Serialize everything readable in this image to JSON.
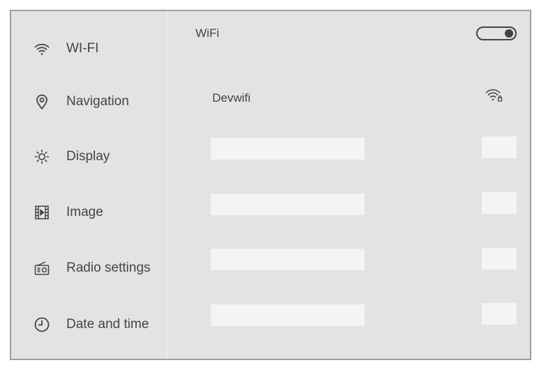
{
  "sidebar": {
    "items": [
      {
        "label": "WI-FI",
        "icon": "wifi-icon"
      },
      {
        "label": "Navigation",
        "icon": "location-pin-icon"
      },
      {
        "label": "Display",
        "icon": "brightness-icon"
      },
      {
        "label": "Image",
        "icon": "film-icon"
      },
      {
        "label": "Radio settings",
        "icon": "radio-icon"
      },
      {
        "label": "Date and time",
        "icon": "clock-icon"
      }
    ]
  },
  "main": {
    "title": "WiFi",
    "toggle_on": true,
    "networks": [
      {
        "name": "Devwifi",
        "icon": "wifi-locked-icon"
      }
    ]
  },
  "colors": {
    "background": "#e3e3e3",
    "text": "#444444",
    "placeholder": "#f4f4f4",
    "border": "#9e9e9e"
  }
}
